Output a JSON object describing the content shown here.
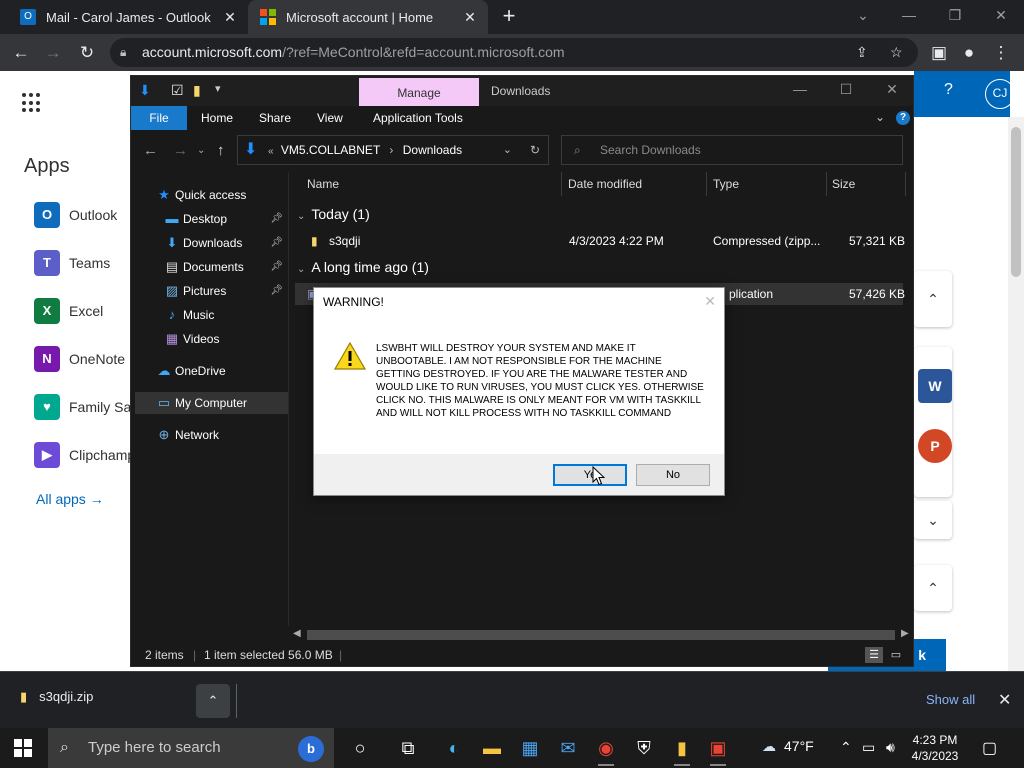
{
  "browser": {
    "tabs": [
      {
        "title": "Mail - Carol James - Outlook",
        "close": "✕"
      },
      {
        "title": "Microsoft account | Home",
        "close": "✕"
      }
    ],
    "new_tab": "+",
    "window_controls": {
      "tab_search": "⌄",
      "minimize": "—",
      "restore": "❐",
      "close": "✕"
    },
    "url_host": "account.microsoft.com",
    "url_path": "/?ref=MeControl&refd=account.microsoft.com"
  },
  "ms_page": {
    "apps_title": "Apps",
    "apps": [
      {
        "label": "Outlook",
        "icon_text": "O",
        "color": "#0f6cbd"
      },
      {
        "label": "Teams",
        "icon_text": "T",
        "color": "#5b5fc7"
      },
      {
        "label": "Excel",
        "icon_text": "X",
        "color": "#107c41"
      },
      {
        "label": "OneNote",
        "icon_text": "N",
        "color": "#7719aa"
      },
      {
        "label": "Family Saf",
        "icon_text": "♥",
        "color": "#00a88f"
      },
      {
        "label": "Clipchamp",
        "icon_text": "▶",
        "color": "#6b4bd8"
      }
    ],
    "all_apps": "All apps  →",
    "help": "?",
    "avatar": "CJ",
    "button_fragment": "k"
  },
  "explorer": {
    "manage_tab": "Manage",
    "title": "Downloads",
    "ribbon_tabs": [
      "File",
      "Home",
      "Share",
      "View",
      "Application Tools"
    ],
    "address": {
      "root": "VM5.COLLABNET",
      "sep": "›",
      "current": "Downloads"
    },
    "search_placeholder": "Search Downloads",
    "nav_items": [
      {
        "label": "Quick access",
        "icon": "★",
        "pinned": false
      },
      {
        "label": "Desktop",
        "icon": "▬",
        "pinned": true
      },
      {
        "label": "Downloads",
        "icon": "↓",
        "pinned": true
      },
      {
        "label": "Documents",
        "icon": "▤",
        "pinned": true
      },
      {
        "label": "Pictures",
        "icon": "▨",
        "pinned": true
      },
      {
        "label": "Music",
        "icon": "♪",
        "pinned": false
      },
      {
        "label": "Videos",
        "icon": "▦",
        "pinned": false
      },
      {
        "label": "OneDrive",
        "icon": "☁",
        "pinned": false
      },
      {
        "label": "My Computer",
        "icon": "▭",
        "pinned": false
      },
      {
        "label": "Network",
        "icon": "⊕",
        "pinned": false
      }
    ],
    "columns": [
      "Name",
      "Date modified",
      "Type",
      "Size"
    ],
    "groups": [
      {
        "label": "Today (1)"
      },
      {
        "label": "A long time ago (1)"
      }
    ],
    "files": [
      {
        "name": "s3qdji",
        "date": "4/3/2023 4:22 PM",
        "type": "Compressed (zipp...",
        "size": "57,321 KB"
      },
      {
        "name": "",
        "date": "",
        "type": "plication",
        "size": "57,426 KB"
      }
    ],
    "status": {
      "items": "2 items",
      "selected": "1 item selected  56.0 MB"
    }
  },
  "dialog": {
    "title": "WARNING!",
    "message": "LSWBHT WILL DESTROY YOUR SYSTEM AND MAKE IT UNBOOTABLE. I AM NOT RESPONSIBLE FOR THE MACHINE GETTING DESTROYED. IF YOU ARE THE MALWARE TESTER AND WOULD LIKE TO RUN VIRUSES, YOU MUST CLICK YES. OTHERWISE CLICK NO. THIS MALWARE IS ONLY MEANT FOR VM WITH TASKKILL AND WILL NOT KILL PROCESS WITH NO TASKKILL COMMAND",
    "yes_label": "Ye",
    "no_label": "No"
  },
  "downloads_shelf": {
    "file": "s3qdji.zip",
    "show_all": "Show all"
  },
  "taskbar": {
    "search_placeholder": "Type here to search",
    "weather": "47°F",
    "time": "4:23 PM",
    "date": "4/3/2023"
  }
}
